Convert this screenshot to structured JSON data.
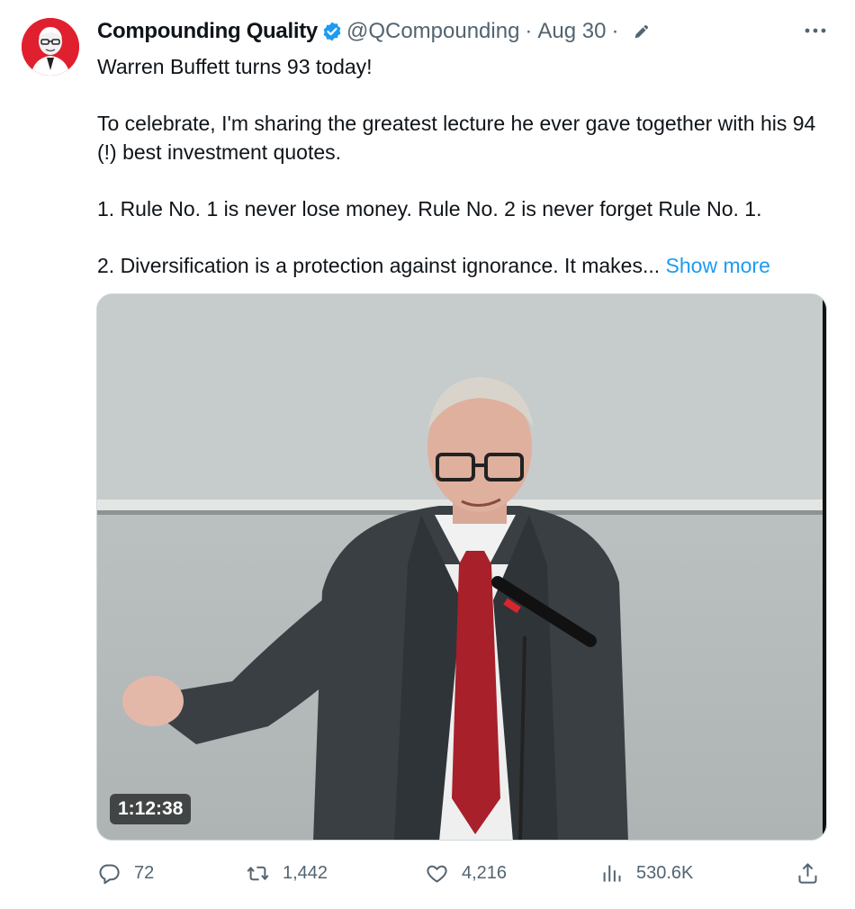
{
  "tweet": {
    "author_name": "Compounding Quality",
    "handle": "@QCompounding",
    "separator": "·",
    "date": "Aug 30",
    "lines": {
      "l1": "Warren Buffett turns 93 today!",
      "l2": "To celebrate, I'm sharing the greatest lecture he ever gave together with his 94 (!) best investment quotes.",
      "l3": "1. Rule No. 1 is never lose money. Rule No. 2 is never forget Rule No. 1.",
      "l4": "2. Diversification is a protection against ignorance. It makes..."
    },
    "show_more": "Show more"
  },
  "media": {
    "duration": "1:12:38"
  },
  "stats": {
    "replies": "72",
    "retweets": "1,442",
    "likes": "4,216",
    "views": "530.6K"
  },
  "icons": {
    "avatar": "buffett-portrait-avatar",
    "verified": "verified-badge-icon",
    "edit": "edited-pencil-icon",
    "more": "more-options-icon",
    "reply": "reply-icon",
    "retweet": "retweet-icon",
    "like": "heart-icon",
    "views": "views-chart-icon",
    "share": "share-icon"
  },
  "colors": {
    "accent": "#1d9bf0",
    "muted_text": "#536471",
    "avatar_bg": "#e0202e"
  }
}
